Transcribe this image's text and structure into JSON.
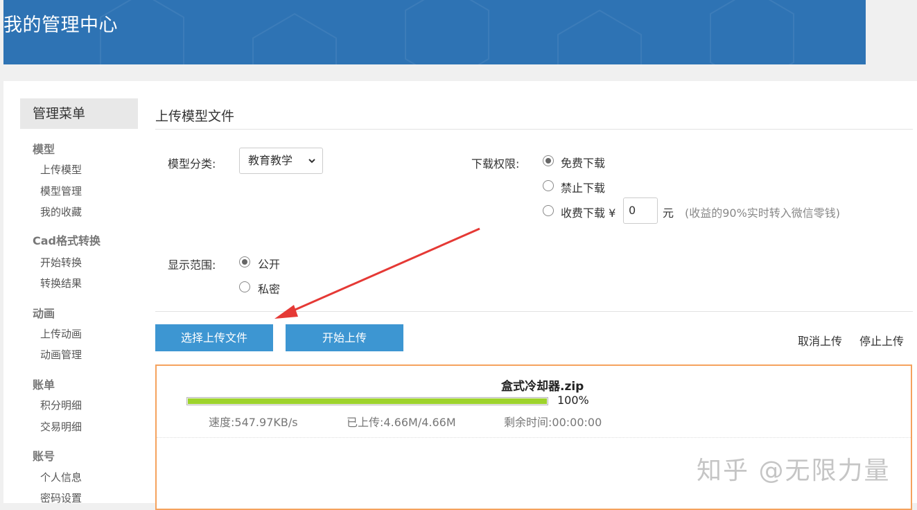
{
  "header": {
    "title": "我的管理中心"
  },
  "sidebar": {
    "heading": "管理菜单",
    "groups": [
      {
        "title": "模型",
        "items": [
          "上传模型",
          "模型管理",
          "我的收藏"
        ]
      },
      {
        "title": "Cad格式转换",
        "items": [
          "开始转换",
          "转换结果"
        ]
      },
      {
        "title": "动画",
        "items": [
          "上传动画",
          "动画管理"
        ]
      },
      {
        "title": "账单",
        "items": [
          "积分明细",
          "交易明细"
        ]
      },
      {
        "title": "账号",
        "items": [
          "个人信息",
          "密码设置"
        ]
      }
    ]
  },
  "form": {
    "title": "上传模型文件",
    "category_label": "模型分类:",
    "category_value": "教育教学",
    "permission_label": "下载权限:",
    "permission_options": [
      "免费下载",
      "禁止下载",
      "收费下载 ¥"
    ],
    "permission_selected": "免费下载",
    "price_value": "0",
    "price_unit": "元",
    "price_hint": "(收益的90%实时转入微信零钱)",
    "visibility_label": "显示范围:",
    "visibility_options": [
      "公开",
      "私密"
    ],
    "visibility_selected": "公开"
  },
  "actions": {
    "choose_file": "选择上传文件",
    "start_upload": "开始上传",
    "cancel_upload": "取消上传",
    "stop_upload": "停止上传"
  },
  "upload": {
    "file_name": "盒式冷却器.zip",
    "progress": 1.0,
    "progress_text": "100%",
    "speed": "速度:547.97KB/s",
    "uploaded": "已上传:4.66M/4.66M",
    "remaining": "剩余时间:00:00:00"
  },
  "watermark": "知乎 @无限力量",
  "colors": {
    "banner": "#2e73b4",
    "button": "#3d96d2",
    "progress": "#9ed32c",
    "box_border": "#f5a25d",
    "arrow": "#e53935"
  }
}
